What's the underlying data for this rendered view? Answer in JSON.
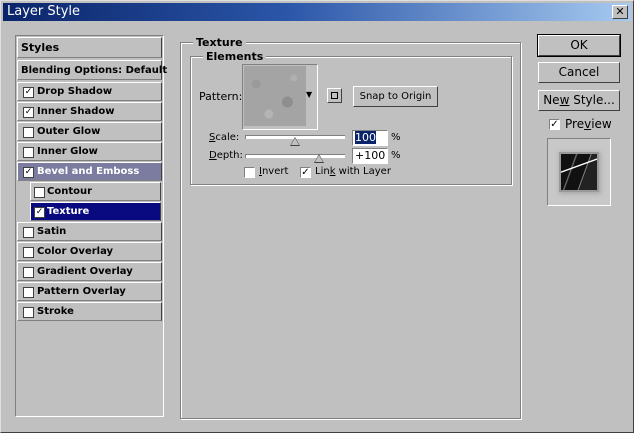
{
  "window": {
    "title": "Layer Style",
    "close_glyph": "✕"
  },
  "styles_list": {
    "header": "Styles",
    "blending": "Blending Options: Default",
    "items": [
      {
        "label": "Drop Shadow",
        "checked": true
      },
      {
        "label": "Inner Shadow",
        "checked": true
      },
      {
        "label": "Outer Glow",
        "checked": false
      },
      {
        "label": "Inner Glow",
        "checked": false
      },
      {
        "label": "Bevel and Emboss",
        "checked": true
      },
      {
        "label": "Contour",
        "checked": false
      },
      {
        "label": "Texture",
        "checked": true
      },
      {
        "label": "Satin",
        "checked": false
      },
      {
        "label": "Color Overlay",
        "checked": false
      },
      {
        "label": "Gradient Overlay",
        "checked": false
      },
      {
        "label": "Pattern Overlay",
        "checked": false
      },
      {
        "label": "Stroke",
        "checked": false
      }
    ]
  },
  "panel": {
    "title": "Texture",
    "group_title": "Elements",
    "pattern_label": "Pattern:",
    "snap_button": "Snap to Origin",
    "scale_label_u": "S",
    "scale_label_rest": "cale:",
    "scale_value": "100",
    "scale_unit": "%",
    "scale_level_percent": 100,
    "depth_label_u": "D",
    "depth_label_rest": "epth:",
    "depth_value": "+100",
    "depth_unit": "%",
    "depth_level_percent": 100,
    "invert_u": "I",
    "invert_rest": "nvert",
    "invert_checked": false,
    "link_u": "k",
    "link_pre": "Lin",
    "link_rest": " with Layer",
    "link_checked": true
  },
  "buttons": {
    "ok": "OK",
    "cancel": "Cancel",
    "new_style_pre": "Ne",
    "new_style_u": "w",
    "new_style_rest": " Style...",
    "preview_pre": "Pre",
    "preview_u": "v",
    "preview_rest": "iew",
    "preview_checked": true
  },
  "colors": {
    "selected_parent": "#7c7ca0",
    "selected_item": "#0a0a80",
    "title_start": "#0a246a"
  },
  "icons": [
    "close-icon",
    "dropdown-arrow-icon",
    "new-preset-icon",
    "check-icon"
  ]
}
